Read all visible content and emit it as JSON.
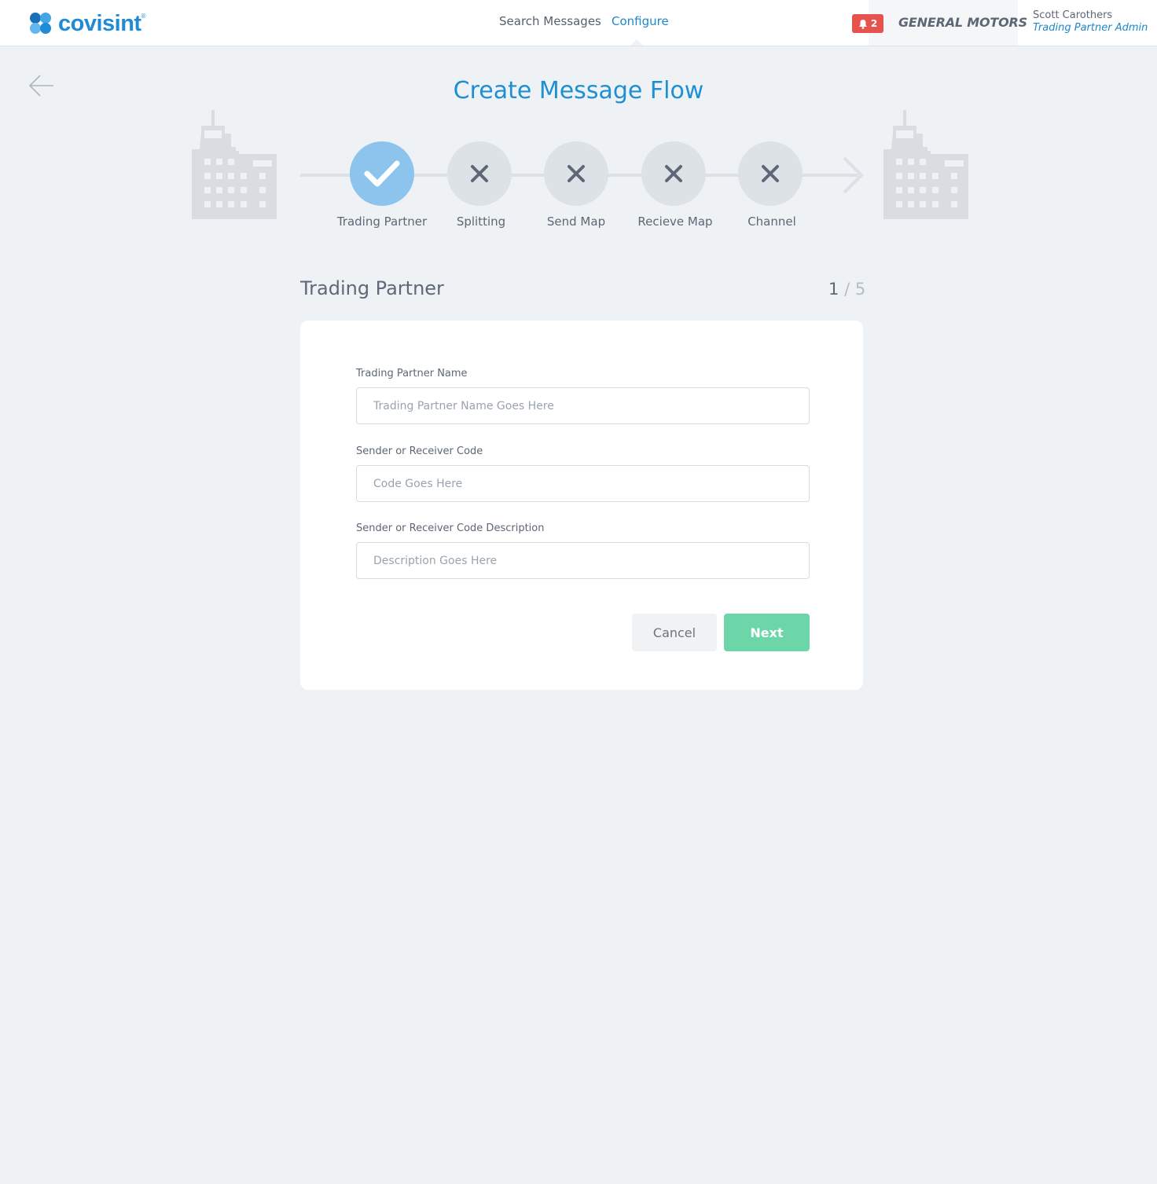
{
  "header": {
    "logo_text": "covisint",
    "nav": [
      {
        "label": "Search Messages",
        "active": false
      },
      {
        "label": "Configure",
        "active": true
      }
    ],
    "notifications_count": "2",
    "company": "GENERAL MOTORS",
    "user": {
      "name": "Scott Carothers",
      "role": "Trading Partner Admin"
    }
  },
  "page": {
    "title": "Create Message Flow"
  },
  "stepper": {
    "steps": [
      {
        "label": "Trading Partner",
        "status": "complete"
      },
      {
        "label": "Splitting",
        "status": "incomplete"
      },
      {
        "label": "Send Map",
        "status": "incomplete"
      },
      {
        "label": "Recieve Map",
        "status": "incomplete"
      },
      {
        "label": "Channel",
        "status": "incomplete"
      }
    ]
  },
  "form": {
    "section_title": "Trading Partner",
    "step_current": "1",
    "step_total": "/ 5",
    "fields": [
      {
        "label": "Trading Partner Name",
        "placeholder": "Trading Partner Name Goes Here",
        "value": ""
      },
      {
        "label": "Sender or Receiver Code",
        "placeholder": "Code Goes Here",
        "value": ""
      },
      {
        "label": "Sender or Receiver Code Description",
        "placeholder": "Description Goes Here",
        "value": ""
      }
    ],
    "cancel_label": "Cancel",
    "next_label": "Next"
  },
  "colors": {
    "accent": "#1e88c9",
    "step_complete": "#8cc4ee",
    "step_incomplete": "#dde2e7",
    "next_button": "#6cd6a8",
    "notification": "#e6524e"
  }
}
